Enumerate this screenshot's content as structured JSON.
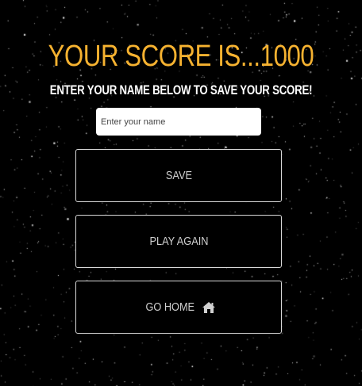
{
  "score": {
    "title": "YOUR SCORE IS...1000"
  },
  "prompt": {
    "text": "ENTER YOUR NAME BELOW TO SAVE YOUR SCORE!"
  },
  "name_input": {
    "placeholder": "Enter your name",
    "value": ""
  },
  "buttons": {
    "save_label": "SAVE",
    "play_again_label": "PLAY AGAIN",
    "go_home_label": "GO HOME",
    "go_home_icon": "home-icon"
  },
  "colors": {
    "background": "#000000",
    "title": "#f6b230",
    "button_border": "#d8d8d8",
    "button_text": "#d0d0d0"
  }
}
